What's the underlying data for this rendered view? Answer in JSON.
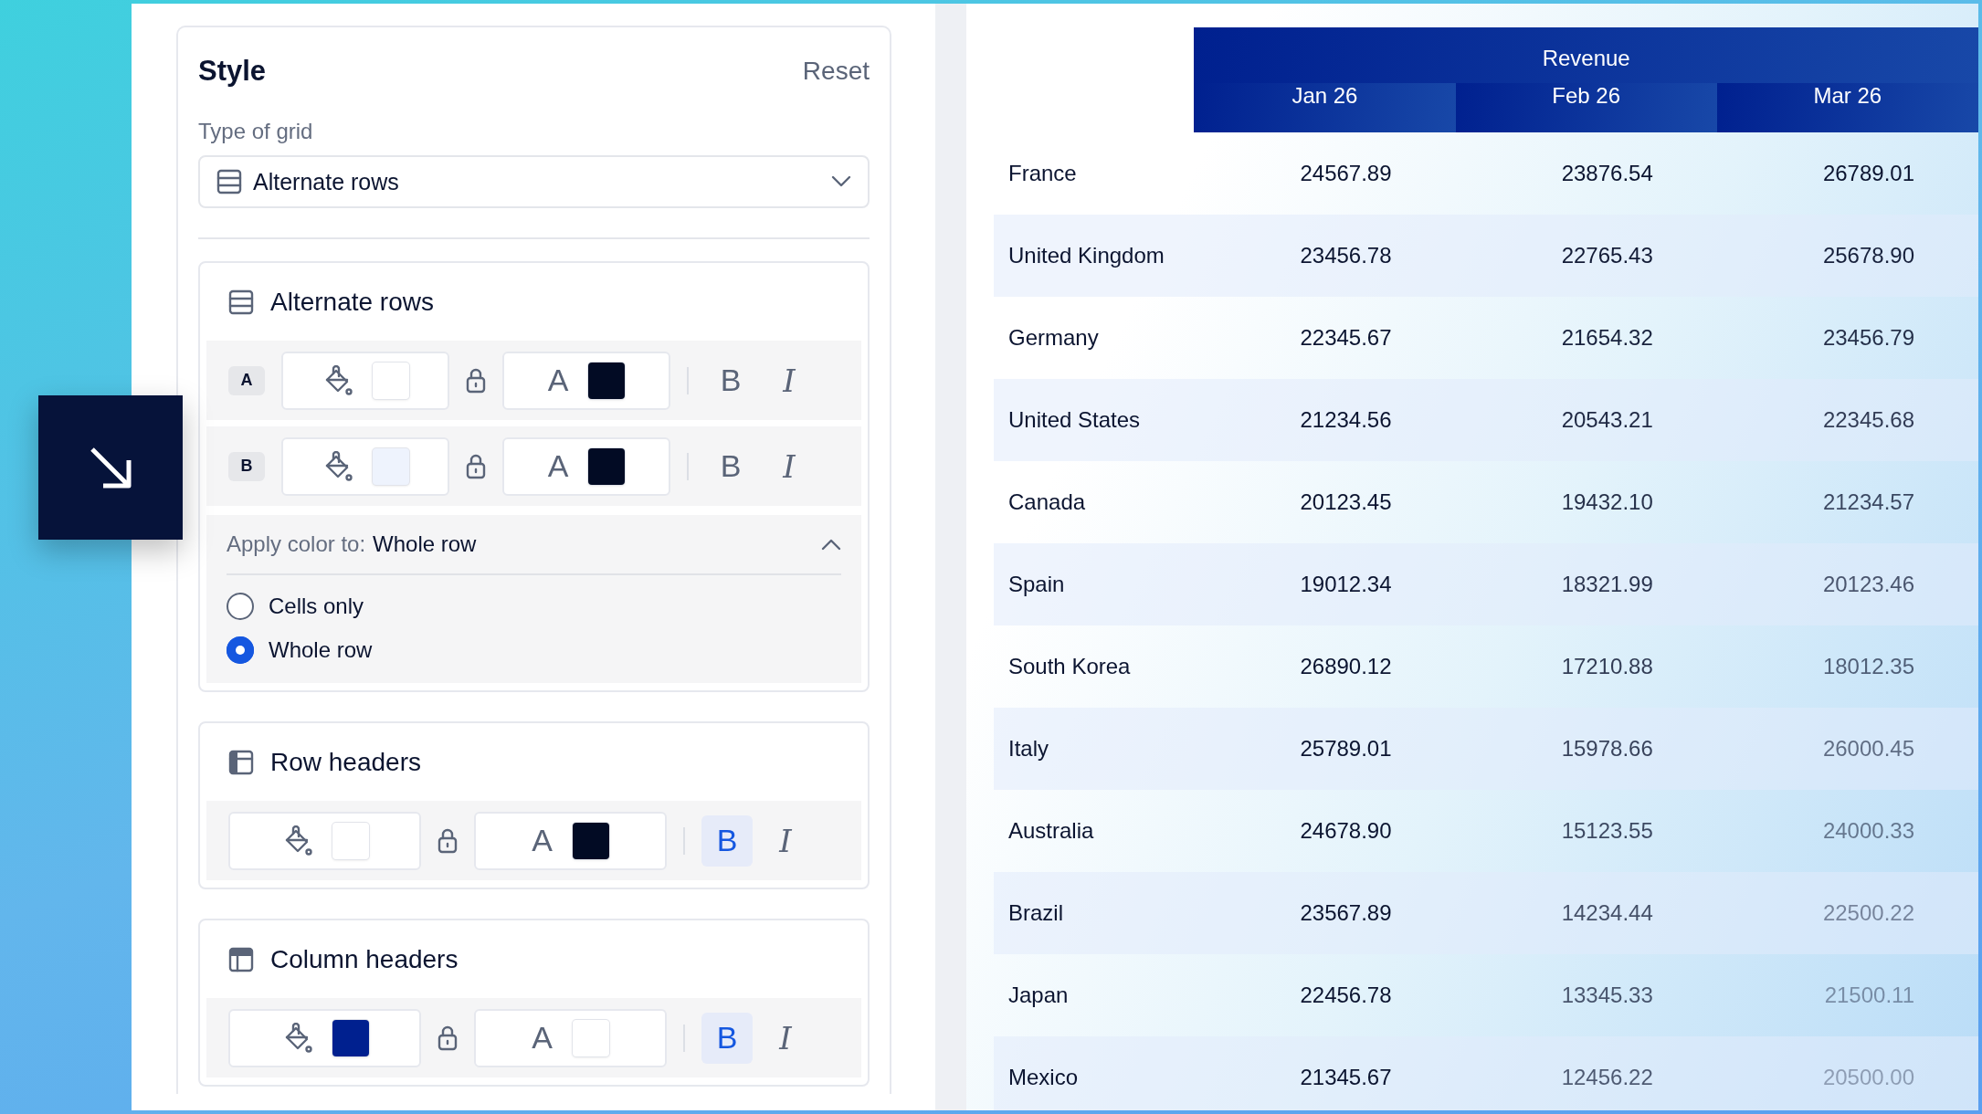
{
  "panel": {
    "title": "Style",
    "reset": "Reset",
    "grid_type": {
      "label": "Type of grid",
      "value": "Alternate rows"
    },
    "sections": [
      {
        "title": "Alternate rows",
        "kind": "alternate",
        "rows": [
          {
            "badge": "A",
            "fill": {
              "color": "#ffffff"
            },
            "font": {
              "label": "A",
              "color": "#020b24"
            },
            "bold": {
              "label": "B",
              "on": false
            },
            "italic": {
              "label": "I",
              "on": false
            }
          },
          {
            "badge": "B",
            "fill": {
              "color": "#eef3fd"
            },
            "font": {
              "label": "A",
              "color": "#020b24"
            },
            "bold": {
              "label": "B",
              "on": false
            },
            "italic": {
              "label": "I",
              "on": false
            }
          }
        ],
        "apply": {
          "label": "Apply color to:",
          "value": "Whole row",
          "expanded": true,
          "options": [
            {
              "label": "Cells only",
              "selected": false
            },
            {
              "label": "Whole row",
              "selected": true
            }
          ]
        }
      },
      {
        "title": "Row headers",
        "kind": "row_headers",
        "rows": [
          {
            "fill": {
              "color": "#ffffff"
            },
            "font": {
              "label": "A",
              "color": "#020b24"
            },
            "bold": {
              "label": "B",
              "on": true
            },
            "italic": {
              "label": "I",
              "on": false
            }
          }
        ]
      },
      {
        "title": "Column headers",
        "kind": "column_headers",
        "rows": [
          {
            "fill": {
              "color": "#00208f"
            },
            "font": {
              "label": "A",
              "color": "#ffffff"
            },
            "bold": {
              "label": "B",
              "on": true
            },
            "italic": {
              "label": "I",
              "on": false
            }
          }
        ]
      }
    ]
  },
  "table": {
    "group_header": "Revenue",
    "columns": [
      "Jan 26",
      "Feb 26",
      "Mar 26"
    ],
    "rows": [
      {
        "label": "France",
        "values": [
          "24567.89",
          "23876.54",
          "26789.01"
        ]
      },
      {
        "label": "United Kingdom",
        "values": [
          "23456.78",
          "22765.43",
          "25678.90"
        ]
      },
      {
        "label": "Germany",
        "values": [
          "22345.67",
          "21654.32",
          "23456.79"
        ]
      },
      {
        "label": "United States",
        "values": [
          "21234.56",
          "20543.21",
          "22345.68"
        ]
      },
      {
        "label": "Canada",
        "values": [
          "20123.45",
          "19432.10",
          "21234.57"
        ]
      },
      {
        "label": "Spain",
        "values": [
          "19012.34",
          "18321.99",
          "20123.46"
        ]
      },
      {
        "label": "South Korea",
        "values": [
          "26890.12",
          "17210.88",
          "18012.35"
        ]
      },
      {
        "label": "Italy",
        "values": [
          "25789.01",
          "15978.66",
          "26000.45"
        ]
      },
      {
        "label": "Australia",
        "values": [
          "24678.90",
          "15123.55",
          "24000.33"
        ]
      },
      {
        "label": "Brazil",
        "values": [
          "23567.89",
          "14234.44",
          "22500.22"
        ]
      },
      {
        "label": "Japan",
        "values": [
          "22456.78",
          "13345.33",
          "21500.11"
        ]
      },
      {
        "label": "Mexico",
        "values": [
          "21345.67",
          "12456.22",
          "20500.00"
        ]
      }
    ]
  }
}
